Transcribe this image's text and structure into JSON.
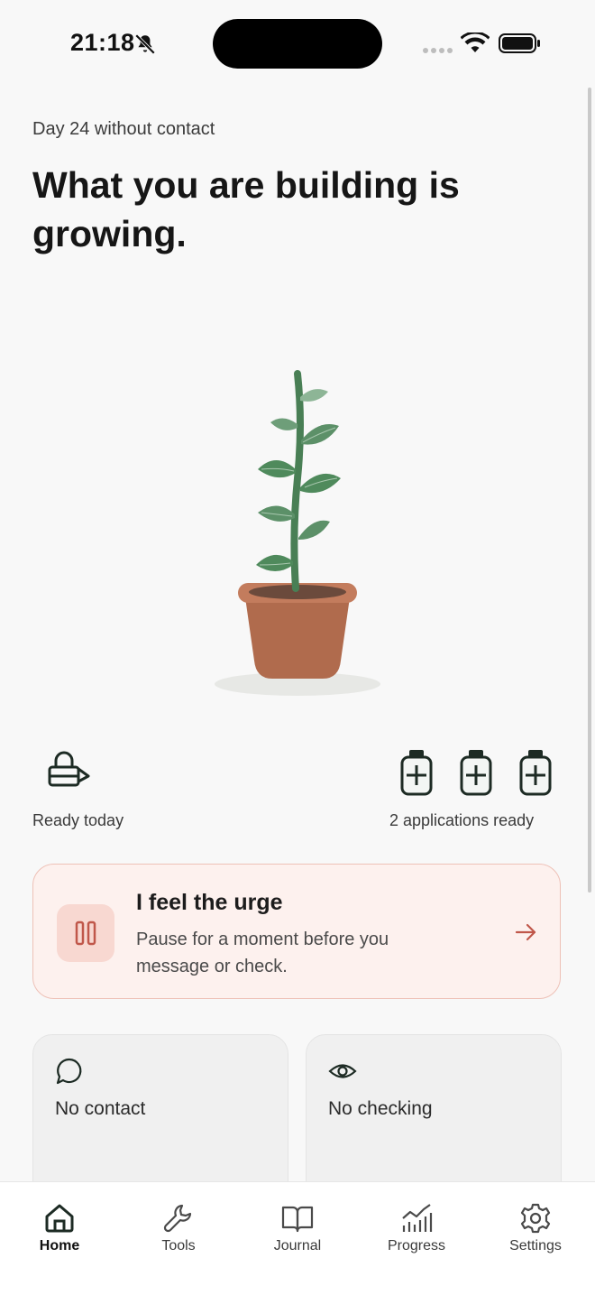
{
  "status_bar": {
    "time": "21:18",
    "icons": [
      "bell-slash-icon",
      "signal-dots-icon",
      "wifi-icon",
      "battery-icon"
    ]
  },
  "header": {
    "day_label": "Day 24 without contact",
    "headline": "What you are building is growing."
  },
  "stats": {
    "left_label": "Ready today",
    "right_label": "2 applications ready",
    "bottle_count": 3
  },
  "urge_card": {
    "title": "I feel the urge",
    "subtitle": "Pause for a moment before you message or check.",
    "icon": "pause-icon",
    "accent": "#c0574a"
  },
  "tiles": [
    {
      "label": "No contact",
      "icon": "chat-bubble-icon"
    },
    {
      "label": "No checking",
      "icon": "eye-icon"
    }
  ],
  "tabbar": {
    "items": [
      {
        "label": "Home",
        "icon": "home-icon",
        "active": true
      },
      {
        "label": "Tools",
        "icon": "wrench-icon",
        "active": false
      },
      {
        "label": "Journal",
        "icon": "book-icon",
        "active": false
      },
      {
        "label": "Progress",
        "icon": "chart-icon",
        "active": false
      },
      {
        "label": "Settings",
        "icon": "gear-icon",
        "active": false
      }
    ]
  },
  "colors": {
    "background": "#f8f8f8",
    "plant_leaf": "#4f8a5c",
    "pot": "#b36b4e",
    "urge_bg": "#fdf1ee",
    "urge_border": "#eec1b7"
  }
}
